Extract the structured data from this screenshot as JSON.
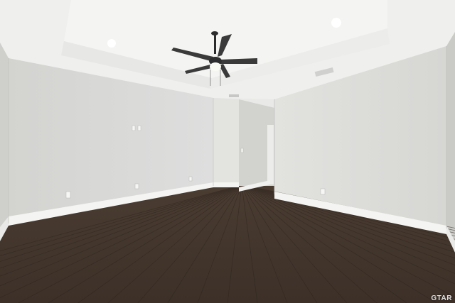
{
  "scene": {
    "description_tags": [
      "empty-room",
      "ceiling-fan",
      "tray-ceiling",
      "dark-wood-floor"
    ],
    "colors": {
      "wall": "#dcdcd9",
      "ceiling": "#f1f1ef",
      "floor_dark": "#3a2f27",
      "floor_light": "#5b4a3d",
      "baseboard": "#f4f4f2"
    }
  },
  "watermark": {
    "text": "GTAR"
  }
}
